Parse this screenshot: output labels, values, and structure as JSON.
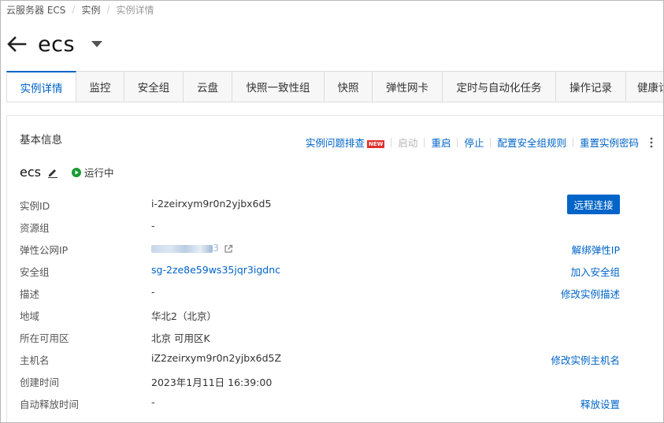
{
  "breadcrumb": {
    "items": [
      "云服务器 ECS",
      "实例",
      "实例详情"
    ],
    "separator": "/"
  },
  "header": {
    "title": "ecs"
  },
  "tabs": [
    {
      "label": "实例详情",
      "active": true
    },
    {
      "label": "监控"
    },
    {
      "label": "安全组"
    },
    {
      "label": "云盘"
    },
    {
      "label": "快照一致性组"
    },
    {
      "label": "快照"
    },
    {
      "label": "弹性网卡"
    },
    {
      "label": "定时与自动化任务"
    },
    {
      "label": "操作记录"
    },
    {
      "label": "健康诊"
    }
  ],
  "basic_info": {
    "title": "基本信息",
    "actions": {
      "troubleshoot": "实例问题排查",
      "new_badge": "NEW",
      "start": "启动",
      "restart": "重启",
      "stop": "停止",
      "config_sg_rules": "配置安全组规则",
      "reset_password": "重置实例密码"
    },
    "instance_name": "ecs",
    "status": "运行中",
    "connect_button": "远程连接",
    "rows": {
      "instance_id": {
        "label": "实例ID",
        "value": "i-2zeirxym9r0n2yjbx6d5"
      },
      "resource_group": {
        "label": "资源组",
        "value": "-"
      },
      "eip": {
        "label": "弹性公网IP",
        "value_suffix": "3",
        "action": "解绑弹性IP"
      },
      "security_group": {
        "label": "安全组",
        "value": "sg-2ze8e59ws35jqr3igdnc",
        "action": "加入安全组"
      },
      "description": {
        "label": "描述",
        "value": "-",
        "action": "修改实例描述"
      },
      "region": {
        "label": "地域",
        "value": "华北2（北京）"
      },
      "zone": {
        "label": "所在可用区",
        "value": "北京 可用区K"
      },
      "hostname": {
        "label": "主机名",
        "value": "iZ2zeirxym9r0n2yjbx6d5Z",
        "action": "修改实例主机名"
      },
      "created_at": {
        "label": "创建时间",
        "value": "2023年1月11日 16:39:00"
      },
      "auto_release": {
        "label": "自动释放时间",
        "value": "-",
        "action": "释放设置"
      }
    }
  },
  "colors": {
    "primary": "#0064c8",
    "running": "#1a9b34",
    "new_badge": "#e0302d",
    "disabled_text": "#b5b5b5"
  },
  "icons": {
    "back": "arrow-left-icon",
    "title_dropdown": "caret-down-icon",
    "edit": "pencil-icon",
    "status": "play-circle-icon",
    "external_link": "external-link-icon",
    "more": "vertical-ellipsis-icon"
  }
}
